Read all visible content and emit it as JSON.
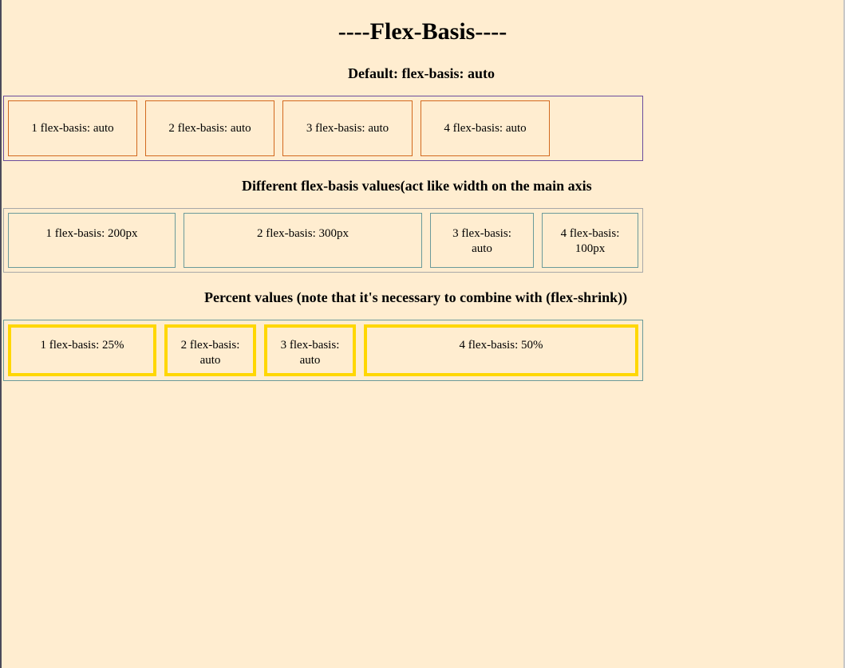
{
  "title": "----Flex-Basis----",
  "section1": {
    "heading": "Default: flex-basis: auto",
    "items": [
      "1 flex-basis: auto",
      "2 flex-basis: auto",
      "3 flex-basis: auto",
      "4 flex-basis: auto"
    ]
  },
  "section2": {
    "heading": "Different flex-basis values(act like width on the main axis",
    "items": [
      "1 flex-basis: 200px",
      "2 flex-basis: 300px",
      "3 flex-basis: auto",
      "4 flex-basis: 100px"
    ]
  },
  "section3": {
    "heading": "Percent values (note that it's necessary to combine with (flex-shrink))",
    "items": [
      "1 flex-basis: 25%",
      "2 flex-basis: auto",
      "3 flex-basis: auto",
      "4 flex-basis: 50%"
    ]
  },
  "colors": {
    "background": "#ffedd0",
    "row1_container": "#6a4c9c",
    "row1_items": "#d2691e",
    "row2_border": "#6b9a9a",
    "row3_items": "#ffd700"
  }
}
